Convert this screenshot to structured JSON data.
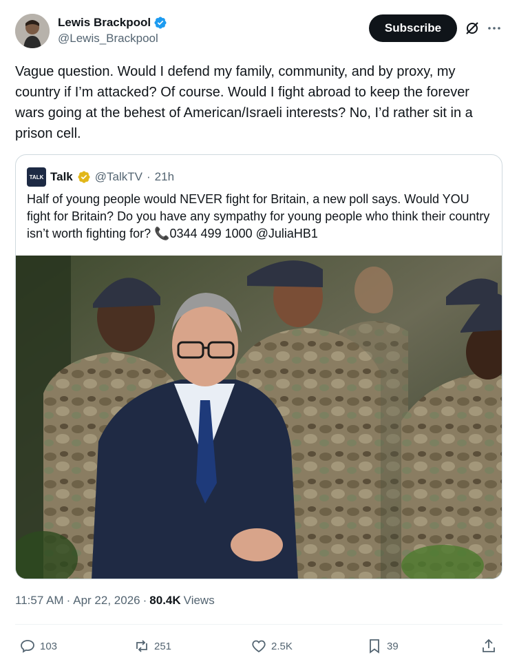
{
  "author": {
    "name": "Lewis Brackpool",
    "handle": "@Lewis_Brackpool",
    "verified": true,
    "avatar": "avatar-icon"
  },
  "header": {
    "subscribe_label": "Subscribe",
    "grok_icon": "grok-icon",
    "more_icon": "more-icon"
  },
  "tweet": {
    "text": "Vague question. Would I defend my family, community, and by proxy, my country if I’m attacked? Of course. Would I fight abroad to keep the forever wars going at the behest of American/Israeli interests? No, I’d rather sit in a prison cell."
  },
  "quote": {
    "logo_text": "TALK",
    "name": "Talk",
    "handle": "@TalkTV",
    "separator": "·",
    "time": "21h",
    "text": "Half of young people would NEVER fight for Britain, a new poll says. Would YOU fight for Britain? Do you have any sympathy for young people who think their country isn’t worth fighting for? 📞0344 499 1000 @JuliaHB1",
    "image": "photo of man in suit in front of soldiers"
  },
  "meta": {
    "time": "11:57 AM",
    "sep1": "·",
    "date": "Apr 22, 2026",
    "sep2": "·",
    "views_count": "80.4K",
    "views_label": "Views"
  },
  "actions": {
    "replies": "103",
    "reposts": "251",
    "likes": "2.5K",
    "bookmarks": "39"
  },
  "colors": {
    "verified": "#1d9bf0",
    "gold_badge": "#e2b719",
    "text": "#0f1419",
    "secondary": "#536471",
    "border": "#cfd9de"
  }
}
